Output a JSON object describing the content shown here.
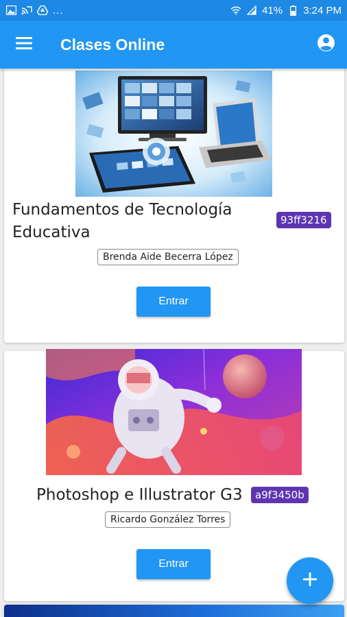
{
  "status_bar": {
    "battery_percent": "41%",
    "time": "3:24 PM",
    "overflow_dots": "...",
    "icons": [
      "image-icon",
      "cast-icon",
      "drive-icon",
      "wifi-icon",
      "signal-icon",
      "battery-icon"
    ]
  },
  "app_bar": {
    "title": "Clases Online",
    "menu_icon": "menu-icon",
    "account_icon": "account-circle-icon"
  },
  "courses": [
    {
      "title": "Fundamentos de Tecnología Educativa",
      "code": "93ff3216",
      "teacher": "Brenda Aide Becerra López",
      "enter_label": "Entrar"
    },
    {
      "title": "Photoshop e Illustrator G3",
      "code": "a9f3450b",
      "teacher": "Ricardo González Torres",
      "enter_label": "Entrar"
    }
  ],
  "fab": {
    "label": "+",
    "icon": "add-icon"
  },
  "colors": {
    "primary": "#2196f3",
    "status_bar": "#1e88e5",
    "badge": "#5e35b1",
    "background": "#eeeeee"
  }
}
